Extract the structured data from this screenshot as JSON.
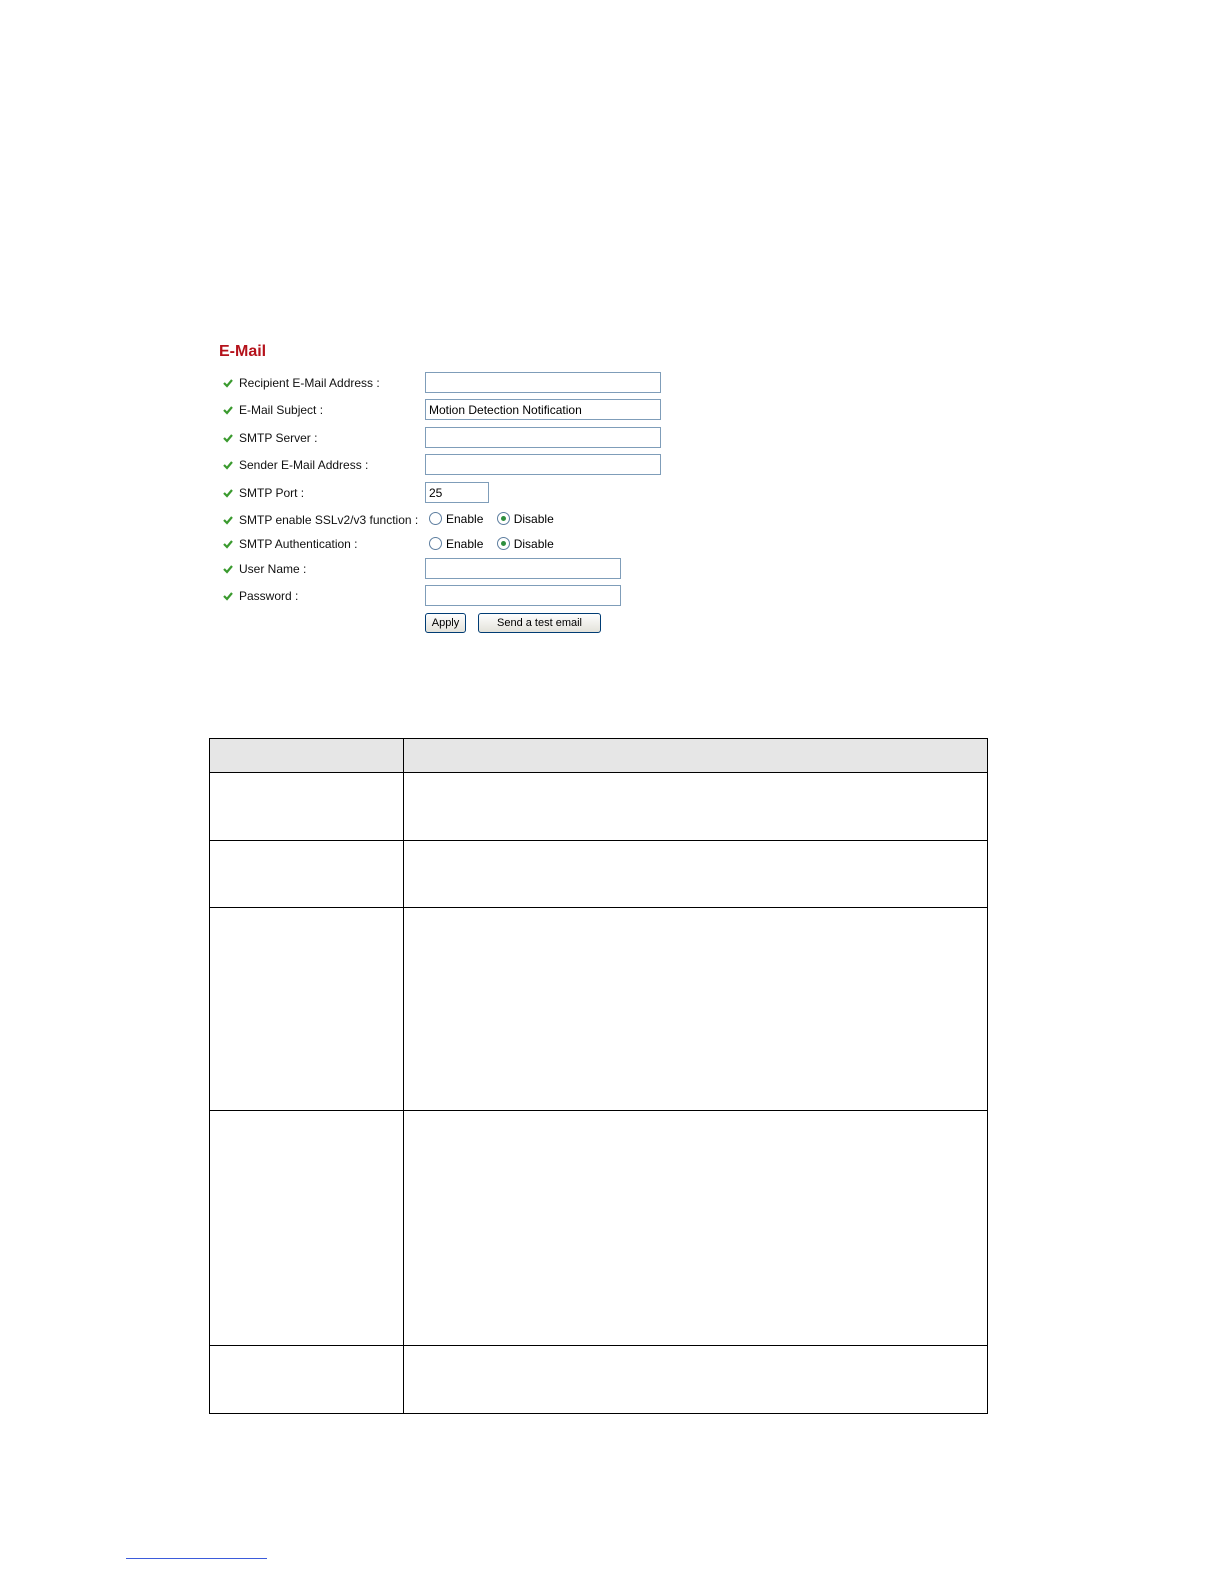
{
  "email_panel": {
    "title": "E-Mail",
    "fields": {
      "recipient": {
        "label": "Recipient E-Mail Address :",
        "value": ""
      },
      "subject": {
        "label": "E-Mail Subject :",
        "value": "Motion Detection Notification"
      },
      "smtp_server": {
        "label": "SMTP Server :",
        "value": ""
      },
      "sender": {
        "label": "Sender E-Mail Address :",
        "value": ""
      },
      "smtp_port": {
        "label": "SMTP Port :",
        "value": "25"
      },
      "ssl": {
        "label": "SMTP enable SSLv2/v3 function :",
        "enable_label": "Enable",
        "disable_label": "Disable",
        "selected": "Disable"
      },
      "auth": {
        "label": "SMTP Authentication :",
        "enable_label": "Enable",
        "disable_label": "Disable",
        "selected": "Disable"
      },
      "username": {
        "label": "User Name :",
        "value": ""
      },
      "password": {
        "label": "Password :",
        "value": ""
      }
    },
    "buttons": {
      "apply": "Apply",
      "test": "Send a test email"
    },
    "icon": "green-check-icon",
    "colors": {
      "title": "#b5121b",
      "check": "#3a9a2e",
      "radio_selected": "#2f8f3f"
    }
  }
}
